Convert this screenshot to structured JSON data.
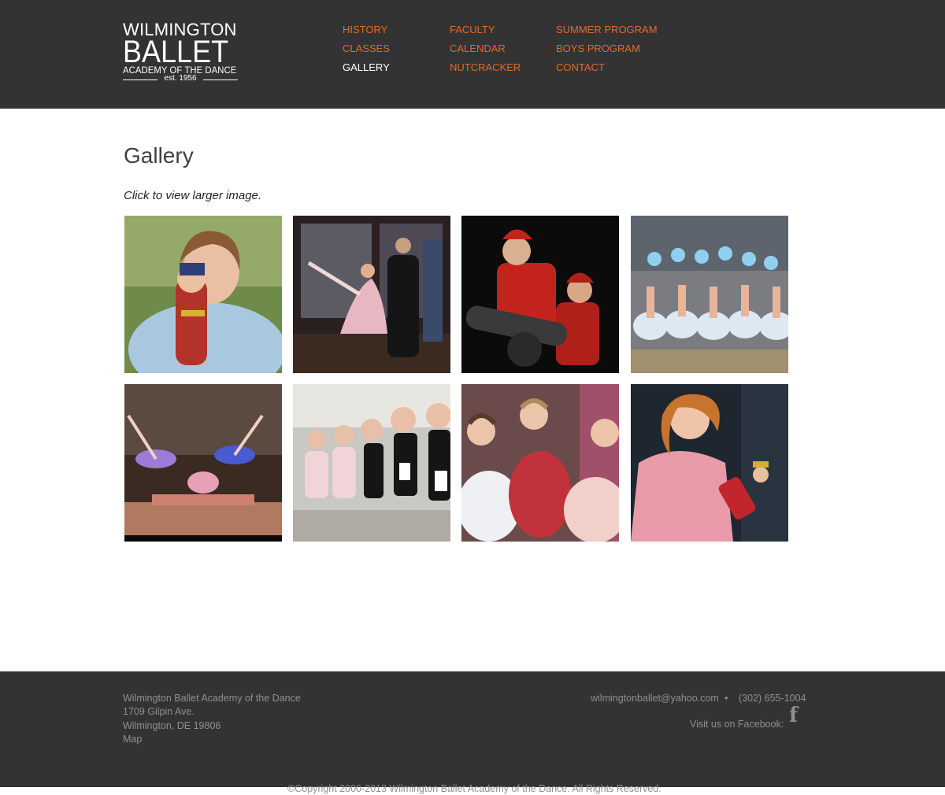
{
  "logo": {
    "line1": "WILMINGTON",
    "line2": "BALLET",
    "line3": "ACADEMY OF THE DANCE",
    "line4": "est. 1956"
  },
  "nav": {
    "history": "HISTORY",
    "classes": "CLASSES",
    "gallery": "GALLERY",
    "faculty": "FACULTY",
    "calendar": "CALENDAR",
    "nutcracker": "NUTCRACKER",
    "summer_program": "SUMMER PROGRAM",
    "boys_program": "BOYS PROGRAM",
    "contact": "CONTACT",
    "active": "GALLERY"
  },
  "page": {
    "title": "Gallery",
    "caption": "Click to view larger image."
  },
  "gallery": {
    "images": [
      "girl holding nutcracker doll",
      "ballerina in pink dress dancing on stage",
      "children in red soldier costumes with cannon",
      "dancers in white tutus with pom-poms",
      "two dancers leaping on stage",
      "young students seated in ballet class",
      "three girls in ballet costumes",
      "girl in pink dress holding nutcracker"
    ]
  },
  "footer": {
    "name": "Wilmington Ballet Academy of the Dance",
    "street": "1709 Gilpin Ave.",
    "city": "Wilmington, DE 19806",
    "map": "Map",
    "email": "wilmingtonballet@yahoo.com",
    "separator": "•",
    "phone": "(302) 655-1004",
    "facebook_label": "Visit us on Facebook:",
    "facebook_icon": "f",
    "copyright": "©Copyright 2000-2013 Wilmington Ballet Academy of the Dance. All Rights Reserved."
  },
  "colors": {
    "header_bg": "#333333",
    "nav_link": "#e36a2e",
    "nav_active": "#ffffff",
    "footer_text": "#8f8f8f"
  }
}
